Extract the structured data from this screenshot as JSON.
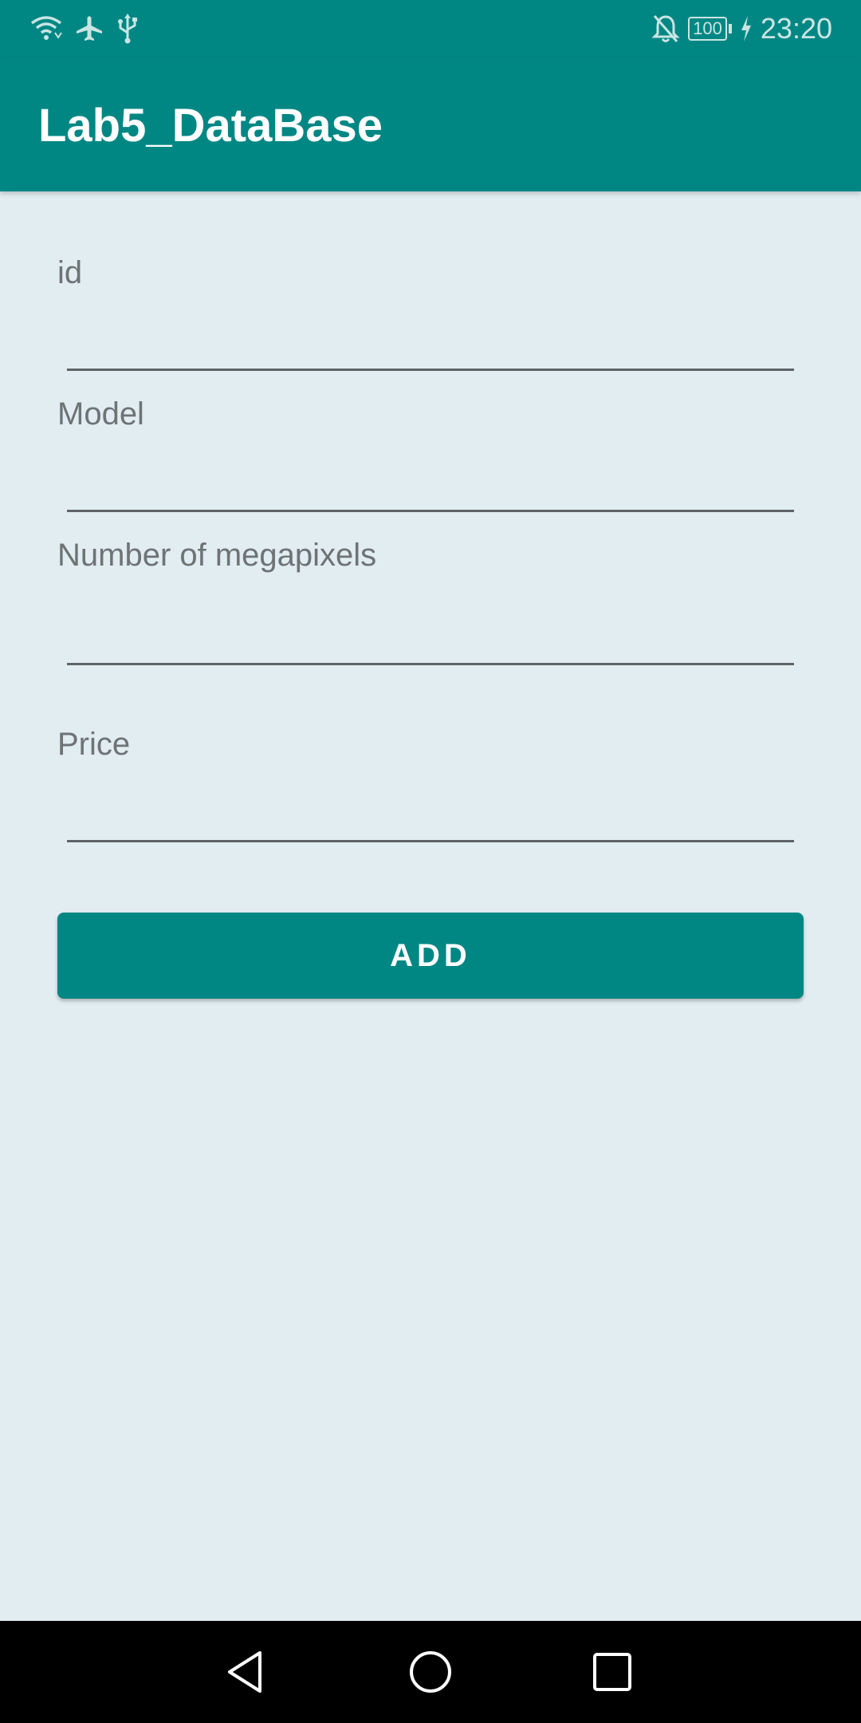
{
  "status_bar": {
    "time": "23:20",
    "battery_level": "100",
    "icons": [
      "wifi-icon",
      "airplane-mode-icon",
      "usb-icon",
      "notifications-off-icon",
      "battery-icon",
      "charging-icon"
    ]
  },
  "app_bar": {
    "title": "Lab5_DataBase"
  },
  "form": {
    "fields": [
      {
        "label": "id",
        "value": ""
      },
      {
        "label": "Model",
        "value": ""
      },
      {
        "label": "Number of megapixels",
        "value": ""
      },
      {
        "label": "Price",
        "value": ""
      }
    ],
    "add_button_label": "ADD"
  },
  "nav_bar": {
    "icons": [
      "back-icon",
      "home-icon",
      "recents-icon"
    ]
  },
  "colors": {
    "primary": "#008784",
    "background": "#E2EDF1",
    "label": "#6E7375"
  }
}
